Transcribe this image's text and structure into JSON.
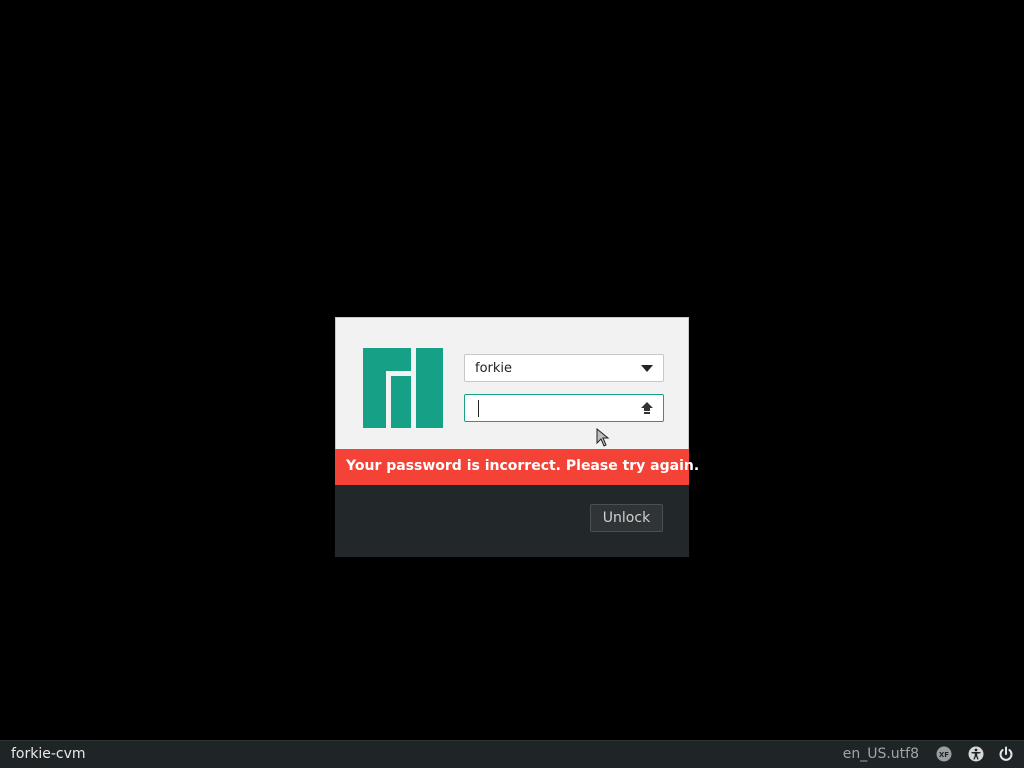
{
  "dialog": {
    "username": "forkie",
    "password_value": "",
    "error_message": "Your password is incorrect. Please try again.",
    "unlock_label": "Unlock"
  },
  "panel": {
    "hostname": "forkie-cvm",
    "locale": "en_US.utf8",
    "keyboard_layout_label": "XF"
  },
  "icons": {
    "logo": "manjaro-logo",
    "capslock": "capslock-icon",
    "dropdown": "chevron-down-icon",
    "keyboard": "keyboard-layout-icon",
    "accessibility": "accessibility-icon",
    "power": "power-icon"
  },
  "colors": {
    "accent": "#16a085",
    "error": "#f44336",
    "panel": "#1f2526",
    "dialog_footer": "#222729"
  }
}
